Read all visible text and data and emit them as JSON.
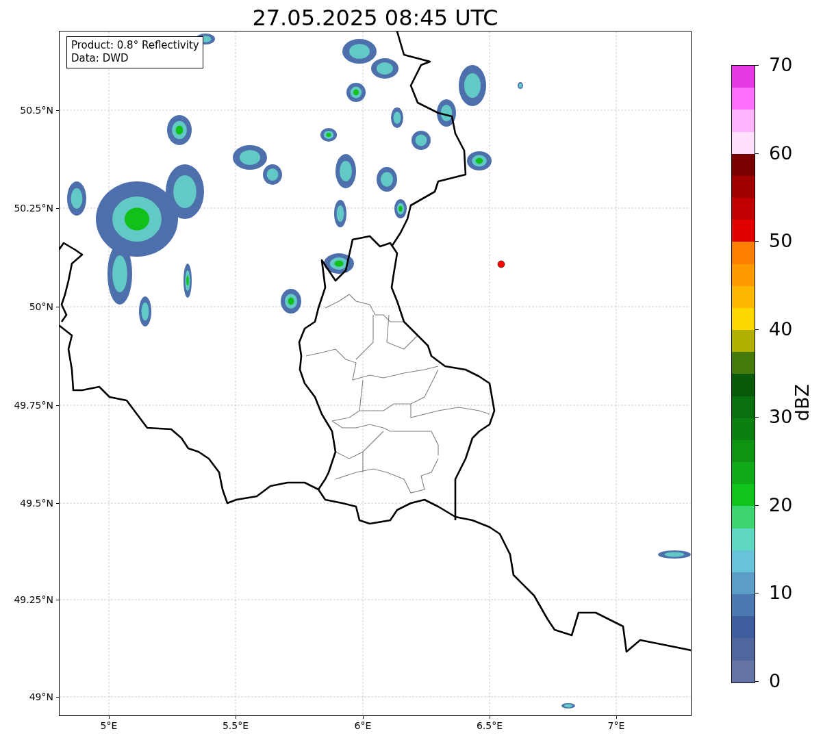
{
  "title": "27.05.2025 08:45 UTC",
  "map": {
    "xticks": [
      "5°E",
      "5.5°E",
      "6°E",
      "6.5°E",
      "7°E"
    ],
    "yticks": [
      "50.5°N",
      "50.25°N",
      "50°N",
      "49.75°N",
      "49.5°N",
      "49.25°N",
      "49°N"
    ],
    "info_box": {
      "lines": [
        "Product: 0.8° Reflectivity",
        "Data: DWD"
      ]
    }
  },
  "colorbar": {
    "label": "dBZ",
    "bands": [
      {
        "color": "#e63ae6"
      },
      {
        "color": "#ff6eff"
      },
      {
        "color": "#ffb3ff"
      },
      {
        "color": "#ffe0ff"
      },
      {
        "color": "#7a0000"
      },
      {
        "color": "#a00000"
      },
      {
        "color": "#c00000"
      },
      {
        "color": "#e00000"
      },
      {
        "color": "#ff7f00"
      },
      {
        "color": "#ff9a00"
      },
      {
        "color": "#ffb800"
      },
      {
        "color": "#ffd700"
      },
      {
        "color": "#b0b000"
      },
      {
        "color": "#467a0a"
      },
      {
        "color": "#085a0a"
      },
      {
        "color": "#0a700e"
      },
      {
        "color": "#0b8010"
      },
      {
        "color": "#0e9412"
      },
      {
        "color": "#10aa16"
      },
      {
        "color": "#10c41a"
      },
      {
        "color": "#3dd56f"
      },
      {
        "color": "#5fd8c3"
      },
      {
        "color": "#66c3da"
      },
      {
        "color": "#5b9ec8"
      },
      {
        "color": "#4a7ab1"
      },
      {
        "color": "#3f5ea0"
      },
      {
        "color": "#52669e"
      },
      {
        "color": "#6474a6"
      }
    ],
    "ticks": [
      "70",
      "60",
      "50",
      "40",
      "30",
      "20",
      "10",
      "0"
    ]
  }
}
